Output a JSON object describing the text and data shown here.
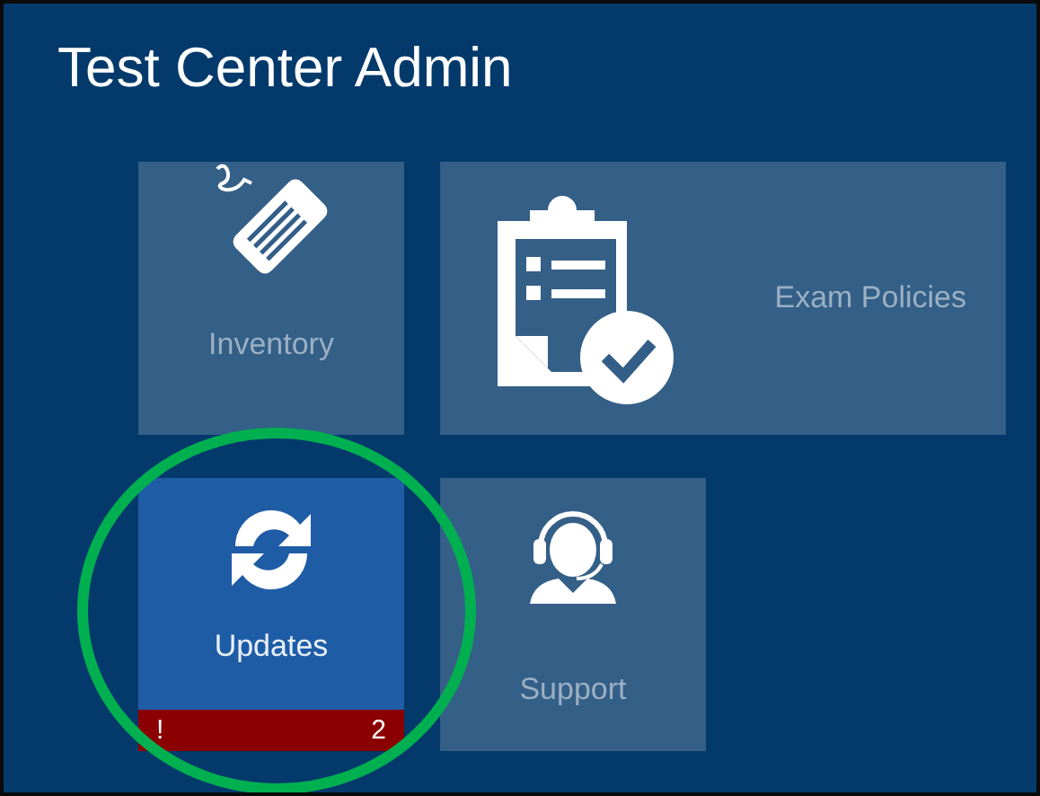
{
  "header": {
    "title": "Test Center Admin"
  },
  "tiles": [
    {
      "label": "Inventory",
      "kind": "tag",
      "selected": false
    },
    {
      "label": "Exam Policies",
      "kind": "clipboard",
      "selected": false
    },
    {
      "label": "Updates",
      "kind": "refresh",
      "selected": true,
      "alert": "!",
      "count": "2"
    },
    {
      "label": "Support",
      "kind": "headset",
      "selected": false
    }
  ],
  "annotation": {
    "kind": "circle",
    "color": "#00b050"
  }
}
